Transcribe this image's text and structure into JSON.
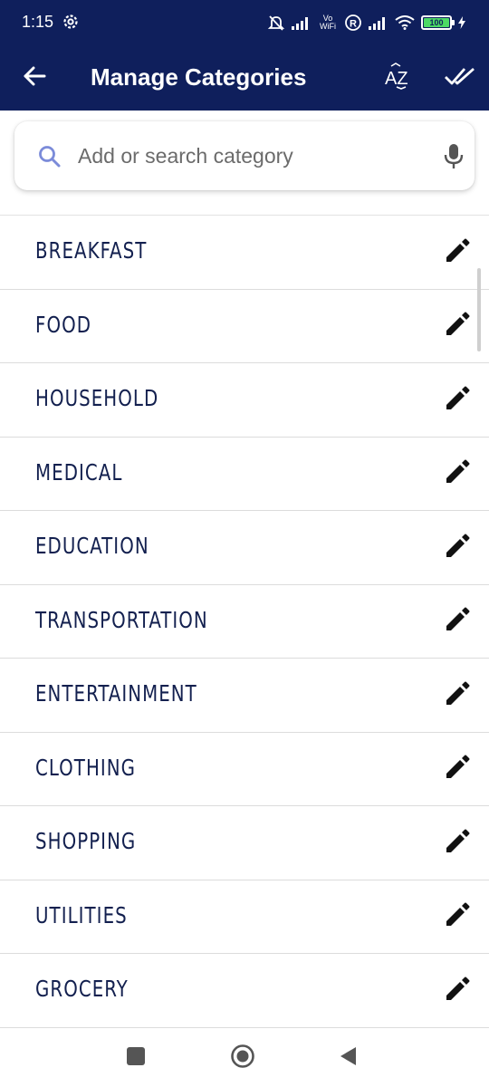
{
  "status_bar": {
    "time": "1:15",
    "vowifi": "Vo WiFi",
    "battery": "100"
  },
  "toolbar": {
    "title": "Manage Categories",
    "sort_label": "AZ"
  },
  "search": {
    "placeholder": "Add or search category",
    "value": ""
  },
  "categories": [
    {
      "label": "BREAKFAST"
    },
    {
      "label": "FOOD"
    },
    {
      "label": "HOUSEHOLD"
    },
    {
      "label": "MEDICAL"
    },
    {
      "label": "EDUCATION"
    },
    {
      "label": "TRANSPORTATION"
    },
    {
      "label": "ENTERTAINMENT"
    },
    {
      "label": "CLOTHING"
    },
    {
      "label": "SHOPPING"
    },
    {
      "label": "UTILITIES"
    },
    {
      "label": "GROCERY"
    }
  ],
  "icons": {
    "back": "arrow-left-icon",
    "sort": "sort-az-icon",
    "done": "double-check-icon",
    "search": "search-icon",
    "mic": "mic-icon",
    "edit": "pencil-icon",
    "nav_recents": "square-icon",
    "nav_home": "circle-icon",
    "nav_back": "triangle-back-icon"
  },
  "colors": {
    "header_bg": "#0f1f5c",
    "item_text": "#13204f",
    "search_icon": "#7b8bd9",
    "battery": "#4cd964"
  }
}
